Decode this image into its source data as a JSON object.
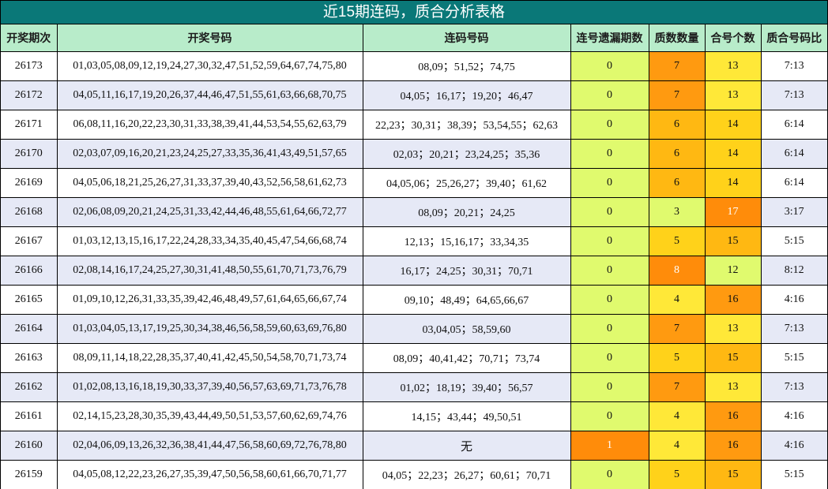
{
  "title": "近15期连码，质合分析表格",
  "headers": [
    "开奖期次",
    "开奖号码",
    "连码号码",
    "连号遗漏期数",
    "质数数量",
    "合号个数",
    "质合号码比"
  ],
  "rows": [
    {
      "issue": "26173",
      "numbers": "01,03,05,08,09,12,19,24,27,30,32,47,51,52,59,64,67,74,75,80",
      "lian": "08,09；51,52；74,75",
      "miss": "0",
      "prime": "7",
      "comp": "13",
      "ratio": "7:13",
      "miss_bg": "#e0fa6e",
      "prime_bg": "#ff9a10",
      "comp_bg": "#ffe838",
      "miss_hot": false,
      "prime_hot": false,
      "comp_hot": false
    },
    {
      "issue": "26172",
      "numbers": "04,05,11,16,17,19,20,26,37,44,46,47,51,55,61,63,66,68,70,75",
      "lian": "04,05；16,17；19,20；46,47",
      "miss": "0",
      "prime": "7",
      "comp": "13",
      "ratio": "7:13",
      "miss_bg": "#e0fa6e",
      "prime_bg": "#ff9a10",
      "comp_bg": "#ffe838",
      "miss_hot": false,
      "prime_hot": false,
      "comp_hot": false
    },
    {
      "issue": "26171",
      "numbers": "06,08,11,16,20,22,23,30,31,33,38,39,41,44,53,54,55,62,63,79",
      "lian": "22,23；30,31；38,39；53,54,55；62,63",
      "miss": "0",
      "prime": "6",
      "comp": "14",
      "ratio": "6:14",
      "miss_bg": "#e0fa6e",
      "prime_bg": "#ffb812",
      "comp_bg": "#ffd21a",
      "miss_hot": false,
      "prime_hot": false,
      "comp_hot": false
    },
    {
      "issue": "26170",
      "numbers": "02,03,07,09,16,20,21,23,24,25,27,33,35,36,41,43,49,51,57,65",
      "lian": "02,03；20,21；23,24,25；35,36",
      "miss": "0",
      "prime": "6",
      "comp": "14",
      "ratio": "6:14",
      "miss_bg": "#e0fa6e",
      "prime_bg": "#ffb812",
      "comp_bg": "#ffd21a",
      "miss_hot": false,
      "prime_hot": false,
      "comp_hot": false
    },
    {
      "issue": "26169",
      "numbers": "04,05,06,18,21,25,26,27,31,33,37,39,40,43,52,56,58,61,62,73",
      "lian": "04,05,06；25,26,27；39,40；61,62",
      "miss": "0",
      "prime": "6",
      "comp": "14",
      "ratio": "6:14",
      "miss_bg": "#e0fa6e",
      "prime_bg": "#ffb812",
      "comp_bg": "#ffd21a",
      "miss_hot": false,
      "prime_hot": false,
      "comp_hot": false
    },
    {
      "issue": "26168",
      "numbers": "02,06,08,09,20,21,24,25,31,33,42,44,46,48,55,61,64,66,72,77",
      "lian": "08,09；20,21；24,25",
      "miss": "0",
      "prime": "3",
      "comp": "17",
      "ratio": "3:17",
      "miss_bg": "#e0fa6e",
      "prime_bg": "#e0fa6e",
      "comp_bg": "#ff8c0a",
      "miss_hot": false,
      "prime_hot": false,
      "comp_hot": true
    },
    {
      "issue": "26167",
      "numbers": "01,03,12,13,15,16,17,22,24,28,33,34,35,40,45,47,54,66,68,74",
      "lian": "12,13；15,16,17；33,34,35",
      "miss": "0",
      "prime": "5",
      "comp": "15",
      "ratio": "5:15",
      "miss_bg": "#e0fa6e",
      "prime_bg": "#ffd21a",
      "comp_bg": "#ffb812",
      "miss_hot": false,
      "prime_hot": false,
      "comp_hot": false
    },
    {
      "issue": "26166",
      "numbers": "02,08,14,16,17,24,25,27,30,31,41,48,50,55,61,70,71,73,76,79",
      "lian": "16,17；24,25；30,31；70,71",
      "miss": "0",
      "prime": "8",
      "comp": "12",
      "ratio": "8:12",
      "miss_bg": "#e0fa6e",
      "prime_bg": "#ff8c0a",
      "comp_bg": "#e0fa6e",
      "miss_hot": false,
      "prime_hot": true,
      "comp_hot": false
    },
    {
      "issue": "26165",
      "numbers": "01,09,10,12,26,31,33,35,39,42,46,48,49,57,61,64,65,66,67,74",
      "lian": "09,10；48,49；64,65,66,67",
      "miss": "0",
      "prime": "4",
      "comp": "16",
      "ratio": "4:16",
      "miss_bg": "#e0fa6e",
      "prime_bg": "#ffe838",
      "comp_bg": "#ff9a10",
      "miss_hot": false,
      "prime_hot": false,
      "comp_hot": false
    },
    {
      "issue": "26164",
      "numbers": "01,03,04,05,13,17,19,25,30,34,38,46,56,58,59,60,63,69,76,80",
      "lian": "03,04,05；58,59,60",
      "miss": "0",
      "prime": "7",
      "comp": "13",
      "ratio": "7:13",
      "miss_bg": "#e0fa6e",
      "prime_bg": "#ff9a10",
      "comp_bg": "#ffe838",
      "miss_hot": false,
      "prime_hot": false,
      "comp_hot": false
    },
    {
      "issue": "26163",
      "numbers": "08,09,11,14,18,22,28,35,37,40,41,42,45,50,54,58,70,71,73,74",
      "lian": "08,09；40,41,42；70,71；73,74",
      "miss": "0",
      "prime": "5",
      "comp": "15",
      "ratio": "5:15",
      "miss_bg": "#e0fa6e",
      "prime_bg": "#ffd21a",
      "comp_bg": "#ffb812",
      "miss_hot": false,
      "prime_hot": false,
      "comp_hot": false
    },
    {
      "issue": "26162",
      "numbers": "01,02,08,13,16,18,19,30,33,37,39,40,56,57,63,69,71,73,76,78",
      "lian": "01,02；18,19；39,40；56,57",
      "miss": "0",
      "prime": "7",
      "comp": "13",
      "ratio": "7:13",
      "miss_bg": "#e0fa6e",
      "prime_bg": "#ff9a10",
      "comp_bg": "#ffe838",
      "miss_hot": false,
      "prime_hot": false,
      "comp_hot": false
    },
    {
      "issue": "26161",
      "numbers": "02,14,15,23,28,30,35,39,43,44,49,50,51,53,57,60,62,69,74,76",
      "lian": "14,15；43,44；49,50,51",
      "miss": "0",
      "prime": "4",
      "comp": "16",
      "ratio": "4:16",
      "miss_bg": "#e0fa6e",
      "prime_bg": "#ffe838",
      "comp_bg": "#ff9a10",
      "miss_hot": false,
      "prime_hot": false,
      "comp_hot": false
    },
    {
      "issue": "26160",
      "numbers": "02,04,06,09,13,26,32,36,38,41,44,47,56,58,60,69,72,76,78,80",
      "lian": "无",
      "miss": "1",
      "prime": "4",
      "comp": "16",
      "ratio": "4:16",
      "miss_bg": "#ff8c0a",
      "prime_bg": "#ffe838",
      "comp_bg": "#ff9a10",
      "miss_hot": true,
      "prime_hot": false,
      "comp_hot": false
    },
    {
      "issue": "26159",
      "numbers": "04,05,08,12,22,23,26,27,35,39,47,50,56,58,60,61,66,70,71,77",
      "lian": "04,05；22,23；26,27；60,61；70,71",
      "miss": "0",
      "prime": "5",
      "comp": "15",
      "ratio": "5:15",
      "miss_bg": "#e0fa6e",
      "prime_bg": "#ffd21a",
      "comp_bg": "#ffb812",
      "miss_hot": false,
      "prime_hot": false,
      "comp_hot": false
    }
  ]
}
